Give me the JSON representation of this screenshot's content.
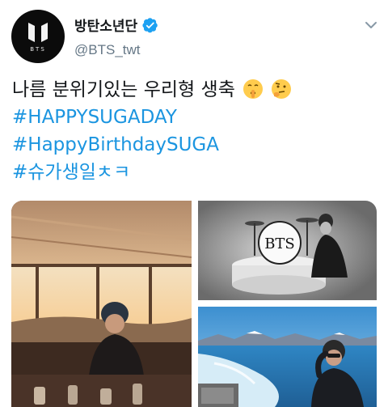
{
  "tweet": {
    "display_name": "방탄소년단",
    "handle": "@BTS_twt",
    "text_line": "나름 분위기있는 우리형 생축",
    "hashtags": [
      "#HAPPYSUGADAY",
      "#HappyBirthdaySUGA",
      "#슈가생일ㅊㅋ"
    ],
    "emojis": [
      "shushing-face-emoji",
      "thinking-face-emoji"
    ]
  },
  "media": {
    "photos": [
      {
        "name": "photo-restaurant-window"
      },
      {
        "name": "photo-drum-kit"
      },
      {
        "name": "photo-boat-lake"
      }
    ],
    "drum_logo": "BTS"
  },
  "avatar": {
    "logo_text": "BTS"
  },
  "colors": {
    "hashtag": "#1b95e0",
    "verified": "#1da1f2",
    "handle": "#657786"
  }
}
